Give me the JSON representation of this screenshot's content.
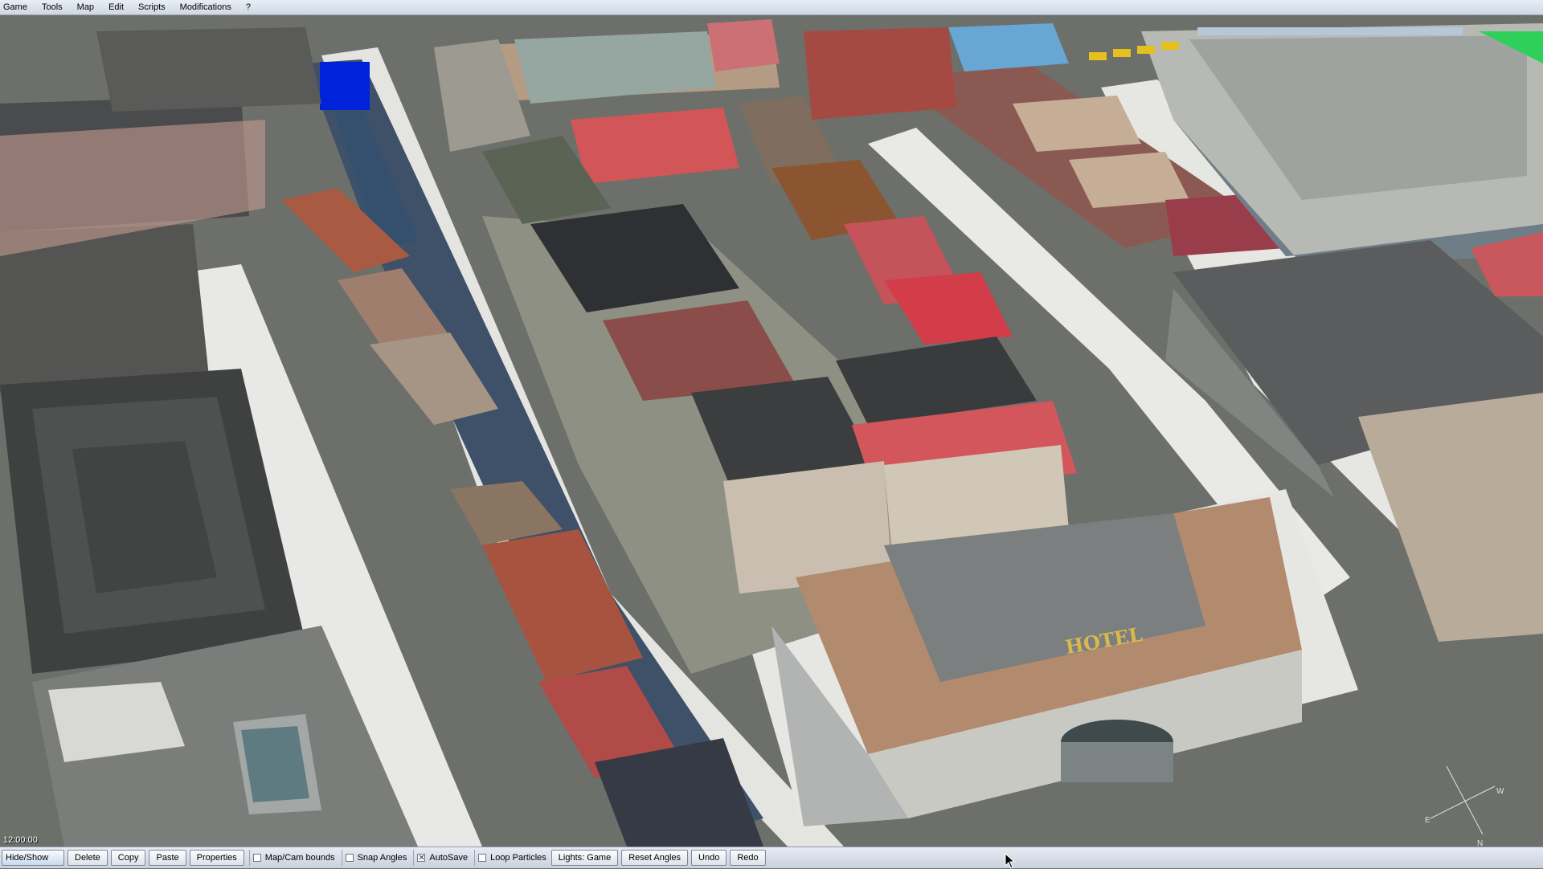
{
  "menu": {
    "items": [
      "Game",
      "Tools",
      "Map",
      "Edit",
      "Scripts",
      "Modifications",
      "?"
    ]
  },
  "viewport": {
    "clock": "12:00:00",
    "hotel_sign": "HOTEL",
    "compass": {
      "north": "N",
      "east": "E",
      "west": "W"
    }
  },
  "toolbar": {
    "hide_show": "Hide/Show",
    "delete": "Delete",
    "copy": "Copy",
    "paste": "Paste",
    "properties": "Properties",
    "map_cam_bounds": {
      "label": "Map/Cam bounds",
      "checked": false
    },
    "snap_angles": {
      "label": "Snap Angles",
      "checked": false
    },
    "autosave": {
      "label": "AutoSave",
      "checked": true
    },
    "loop_particles": {
      "label": "Loop Particles",
      "checked": false
    },
    "lights": "Lights: Game",
    "reset_angles": "Reset Angles",
    "undo": "Undo",
    "redo": "Redo"
  },
  "colors": {
    "road": "#6f716c",
    "sidewalk": "#e6e6e3",
    "canal_water": "#3d4f67",
    "red_roof": "#c0504f",
    "dark_roof": "#3d3f40",
    "brick": "#8b4a3c",
    "menubar": "#dde4ee"
  }
}
